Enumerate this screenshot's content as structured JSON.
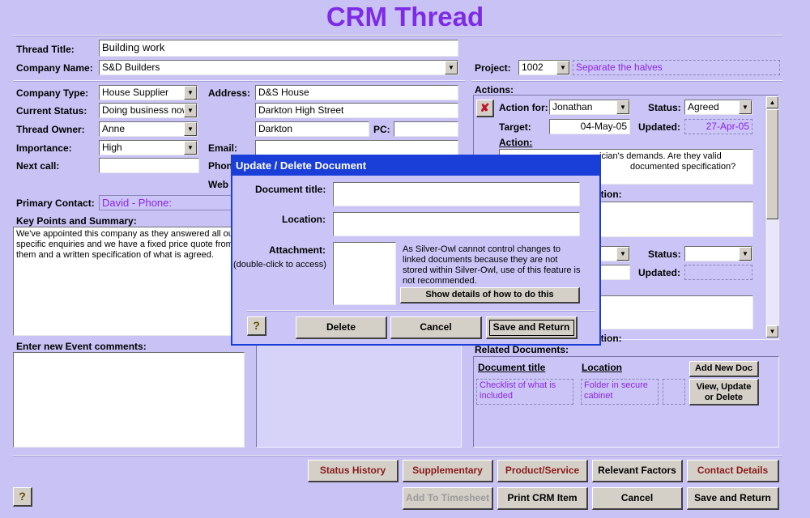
{
  "app": {
    "title": "CRM Thread"
  },
  "thread": {
    "title_label": "Thread Title:",
    "title_value": "Building work",
    "company_name_label": "Company Name:",
    "company_name_value": "S&D Builders",
    "company_type_label": "Company Type:",
    "company_type_value": "House Supplier",
    "current_status_label": "Current Status:",
    "current_status_value": "Doing business now",
    "owner_label": "Thread Owner:",
    "owner_value": "Anne",
    "importance_label": "Importance:",
    "importance_value": "High",
    "next_call_label": "Next call:",
    "next_call_value": "",
    "address_label": "Address:",
    "address_line1": "D&S House",
    "address_line2": "Darkton High Street",
    "address_line3": "Darkton",
    "pc_label": "PC:",
    "pc_value": "",
    "email_label": "Email:",
    "email_value": "",
    "phone_label_partial": "Phon",
    "web_label_partial": "Web",
    "primary_contact_label": "Primary Contact:",
    "primary_contact_value": "David - Phone:",
    "key_points_label": "Key Points and Summary:",
    "key_points_text": "We've appointed this company as they answered all our specific enquiries and we have a fixed price quote from them and a written specification of what is agreed.",
    "event_comments_label": "Enter new Event comments:",
    "event_comments_value": ""
  },
  "project": {
    "label": "Project:",
    "number": "1002",
    "name": "Separate the halves"
  },
  "actions": {
    "label": "Actions:",
    "action_for_label": "Action for:",
    "action_for_value": "Jonathan",
    "status_label": "Status:",
    "status_value": "Agreed",
    "target_label": "Target:",
    "target_value": "04-May-05",
    "updated_label": "Updated:",
    "updated_value": "27-Apr-05",
    "action_label": "Action:",
    "action_text_line1": "ician's demands. Are they valid",
    "action_text_line2": "documented specification?",
    "partial_label_1": "ction:",
    "status2_label": "Status:",
    "status2_value": "",
    "updated2_label": "Updated:",
    "updated2_value": "",
    "partial_label_2": "ction:"
  },
  "related_documents": {
    "label": "Related Documents:",
    "col_title": "Document title",
    "col_location": "Location",
    "add_button": "Add New Doc",
    "view_button": "View, Update or Delete",
    "rows": [
      {
        "title": "Checklist of what is included",
        "location": "Folder in secure cabinet"
      }
    ]
  },
  "dialog": {
    "title": "Update / Delete Document",
    "doc_title_label": "Document title:",
    "doc_title_value": "",
    "location_label": "Location:",
    "location_value": "",
    "attachment_label": "Attachment:",
    "attachment_hint": "(double-click to access)",
    "warning": "As Silver-Owl cannot control changes to linked documents because they are not stored within Silver-Owl, use of this feature is not recommended.",
    "show_details_button": "Show details of how to do this",
    "help_glyph": "?",
    "delete_button": "Delete",
    "cancel_button": "Cancel",
    "save_button": "Save and Return"
  },
  "footer": {
    "help_glyph": "?",
    "status_history": "Status History",
    "supplementary": "Supplementary",
    "product_service": "Product/Service",
    "relevant_factors": "Relevant Factors",
    "contact_details": "Contact Details",
    "add_to_timesheet": "Add To Timesheet",
    "print_crm_item": "Print CRM Item",
    "cancel": "Cancel",
    "save_and_return": "Save and Return"
  },
  "colors": {
    "background": "#c9c3f5",
    "title_purple": "#7f2be6",
    "dialog_titlebar": "#1a3fd8",
    "readonly_text": "#8d23e8",
    "accent_red_text": "#8b1a1a"
  }
}
